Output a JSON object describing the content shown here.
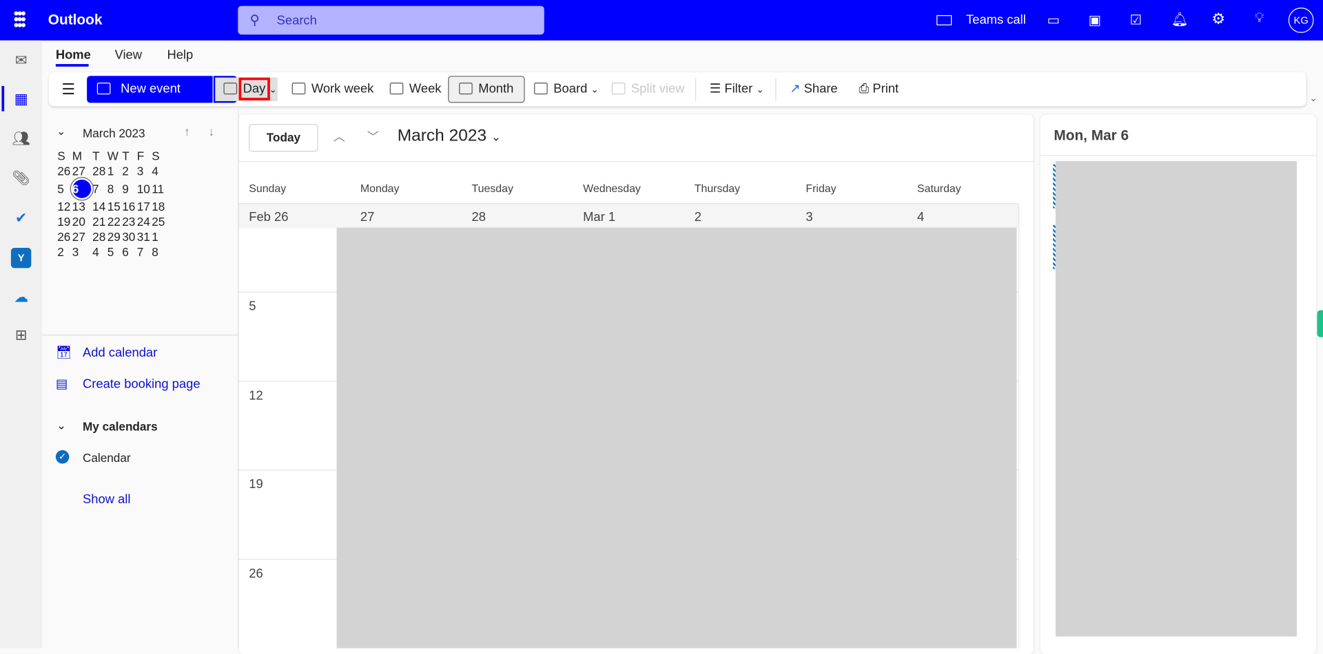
{
  "app": {
    "title": "Outlook",
    "search_placeholder": "Search",
    "teams_call": "Teams call",
    "avatar": "KG",
    "brand_color": "#0000ff"
  },
  "rail": [
    "mail-icon",
    "calendar-icon",
    "people-icon",
    "attachment-icon",
    "todo-icon",
    "yammer-icon",
    "onedrive-icon",
    "apps-icon"
  ],
  "tabs": [
    "Home",
    "View",
    "Help"
  ],
  "toolbar": {
    "new_event": "New event",
    "day": "Day",
    "work_week": "Work week",
    "week": "Week",
    "month": "Month",
    "board": "Board",
    "split_view": "Split view",
    "filter": "Filter",
    "share": "Share",
    "print": "Print"
  },
  "mini_calendar": {
    "title": "March 2023",
    "weekdays": [
      "S",
      "M",
      "T",
      "W",
      "T",
      "F",
      "S"
    ],
    "weeks": [
      [
        "26",
        "27",
        "28",
        "1",
        "2",
        "3",
        "4"
      ],
      [
        "5",
        "6",
        "7",
        "8",
        "9",
        "10",
        "11"
      ],
      [
        "12",
        "13",
        "14",
        "15",
        "16",
        "17",
        "18"
      ],
      [
        "19",
        "20",
        "21",
        "22",
        "23",
        "24",
        "25"
      ],
      [
        "26",
        "27",
        "28",
        "29",
        "30",
        "31",
        "1"
      ],
      [
        "2",
        "3",
        "4",
        "5",
        "6",
        "7",
        "8"
      ]
    ],
    "selected": "6"
  },
  "sidebar": {
    "add_calendar": "Add calendar",
    "create_booking": "Create booking page",
    "my_calendars": "My calendars",
    "calendar": "Calendar",
    "show_all": "Show all"
  },
  "main": {
    "today": "Today",
    "month_title": "March 2023",
    "days": [
      "Sunday",
      "Monday",
      "Tuesday",
      "Wednesday",
      "Thursday",
      "Friday",
      "Saturday"
    ],
    "first_row": [
      "Feb 26",
      "27",
      "28",
      "Mar 1",
      "2",
      "3",
      "4"
    ],
    "week_starts": [
      "5",
      "12",
      "19",
      "26"
    ]
  },
  "right": {
    "title": "Mon, Mar 6"
  }
}
